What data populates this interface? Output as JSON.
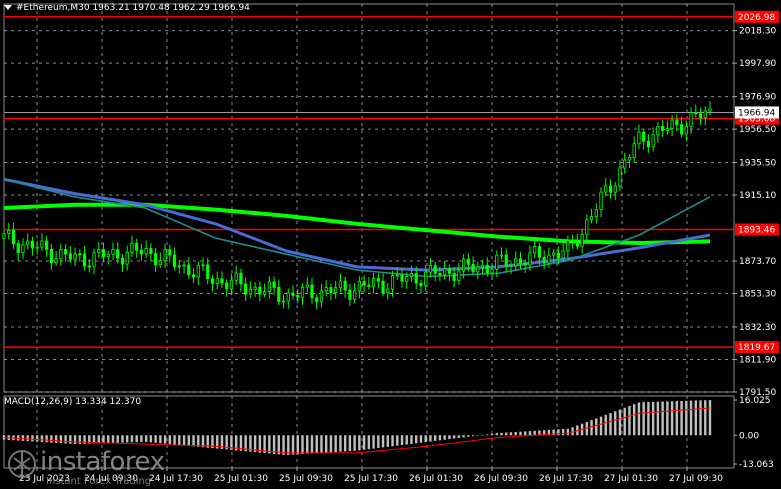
{
  "header": {
    "symbol_line": "#Ethereum,M30  1963.21 1970.48 1962.29 1966.94"
  },
  "price_axis": {
    "ticks": [
      "2018.30",
      "1997.90",
      "1976.90",
      "1956.50",
      "1935.50",
      "1915.10",
      "1873.70",
      "1853.30",
      "1832.30",
      "1811.90",
      "1791.50"
    ]
  },
  "price_scale": {
    "min": 1791.5,
    "max": 2035.0
  },
  "levels": [
    {
      "value": 2026.98,
      "label": "2026.98",
      "color": "#ff0000"
    },
    {
      "value": 1963.08,
      "label": "1963.08",
      "color": "#ff0000"
    },
    {
      "value": 1893.46,
      "label": "1893.46",
      "color": "#ff0000"
    },
    {
      "value": 1819.67,
      "label": "1819.67",
      "color": "#ff0000"
    }
  ],
  "current_price": {
    "value": 1966.94,
    "label": "1966.94"
  },
  "time_axis": {
    "ticks": [
      "23 Jul 2023",
      "24 Jul 09:30",
      "24 Jul 17:30",
      "25 Jul 01:30",
      "25 Jul 09:30",
      "25 Jul 17:30",
      "26 Jul 01:30",
      "26 Jul 09:30",
      "26 Jul 17:30",
      "27 Jul 01:30",
      "27 Jul 09:30"
    ]
  },
  "macd": {
    "label": "MACD(12,26,9) 13.334 12.370",
    "axis_ticks": [
      "16.025",
      "0.00",
      "-13.063"
    ],
    "scale": {
      "min": -13.063,
      "max": 16.025
    }
  },
  "watermark": {
    "brand": "instaforex",
    "tagline": "Instant Forex Trading"
  },
  "colors": {
    "background": "#000000",
    "grid": "#c8c8c8",
    "candle": "#00ff00",
    "level_line": "#ff0000",
    "ma_fast": "#1e8c8c",
    "ma_mid": "#4a6cd4",
    "ma_slow": "#00ff00",
    "macd_hist": "#c0c0c0",
    "macd_signal": "#ff0000"
  },
  "chart_data": {
    "type": "line",
    "title": "#Ethereum,M30",
    "xlabel": "",
    "ylabel": "",
    "ylim": [
      1791.5,
      2035.0
    ],
    "x": [
      "23 Jul 2023",
      "24 Jul 09:30",
      "24 Jul 17:30",
      "25 Jul 01:30",
      "25 Jul 09:30",
      "25 Jul 17:30",
      "26 Jul 01:30",
      "26 Jul 09:30",
      "26 Jul 17:30",
      "27 Jul 01:30",
      "27 Jul 09:30"
    ],
    "series": [
      {
        "values": [
          1888,
          1875,
          1880,
          1862,
          1852,
          1857,
          1865,
          1872,
          1880,
          1950,
          1967
        ]
      },
      {
        "values": [
          1925,
          1914,
          1907,
          1888,
          1878,
          1868,
          1864,
          1866,
          1874,
          1890,
          1914
        ]
      },
      {
        "values": [
          1925,
          1916,
          1909,
          1897,
          1880,
          1870,
          1868,
          1870,
          1875,
          1882,
          1890
        ]
      },
      {
        "values": [
          1907,
          1909,
          1909,
          1906,
          1902,
          1897,
          1893,
          1889,
          1886,
          1885,
          1886
        ]
      }
    ],
    "macd_histogram": [
      -2,
      -4,
      -3,
      -6,
      -9,
      -7,
      -3,
      1,
      3,
      15,
      16
    ],
    "macd_signal": [
      -1,
      -3,
      -4,
      -5,
      -8,
      -8,
      -5,
      -1,
      1,
      10,
      12.37
    ]
  }
}
